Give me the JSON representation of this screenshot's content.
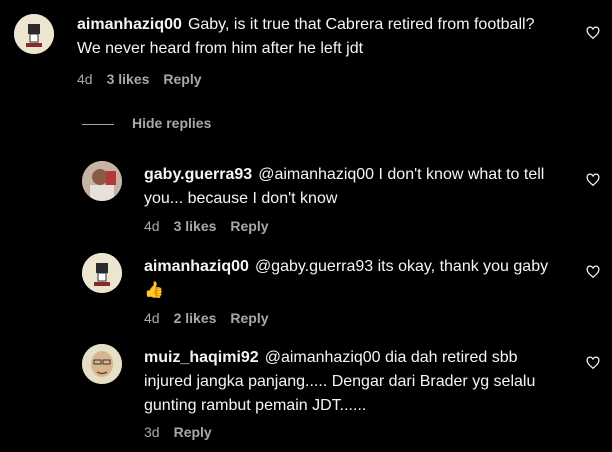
{
  "comments": [
    {
      "username": "aimanhaziq00",
      "text": "Gaby, is it true that Cabrera retired from football? We never heard from him after he left jdt",
      "age": "4d",
      "likes": "3 likes",
      "reply": "Reply",
      "avatar_icon": "fist-logo-avatar"
    },
    {
      "username": "gaby.guerra93",
      "text": "@aimanhaziq00 I don't know what to tell you... because I don't know",
      "age": "4d",
      "likes": "3 likes",
      "reply": "Reply",
      "avatar_icon": "photo-avatar"
    },
    {
      "username": "aimanhaziq00",
      "text": "@gaby.guerra93 its okay, thank you gaby",
      "emoji": "👍",
      "age": "4d",
      "likes": "2 likes",
      "reply": "Reply",
      "avatar_icon": "fist-logo-avatar"
    },
    {
      "username": "muiz_haqimi92",
      "text": "@aimanhaziq00 dia dah retired sbb injured jangka panjang..... Dengar dari Brader yg selalu gunting rambut pemain JDT......",
      "age": "3d",
      "reply": "Reply",
      "avatar_icon": "face-avatar"
    }
  ],
  "hide_replies": "Hide replies",
  "colors": {
    "background": "#000000",
    "text": "#f5f5f5",
    "muted": "#a8a8a8"
  },
  "icons": {
    "like": "heart-outline-icon"
  }
}
